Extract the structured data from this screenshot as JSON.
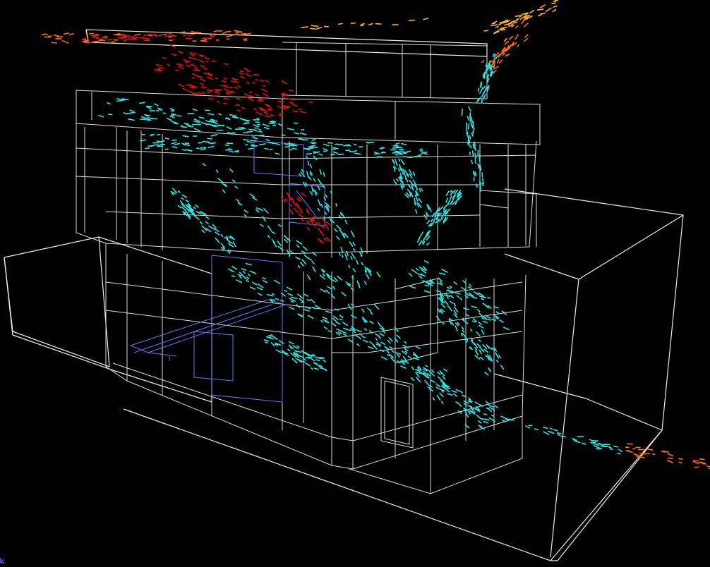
{
  "scene": {
    "type": "cfd-airflow-visualization",
    "background": "#000000",
    "colors": {
      "building_wireframe": "#e8e8e8",
      "outer_domain": "#f2f0c8",
      "interior_fixtures": "#7070ff",
      "flow_low": "#27e6e6",
      "flow_mid": "#ffb020",
      "flow_high": "#e01010",
      "flow_orange": "#ff6a10"
    },
    "icons": {
      "axis_marker": "axis-triad-icon"
    }
  }
}
